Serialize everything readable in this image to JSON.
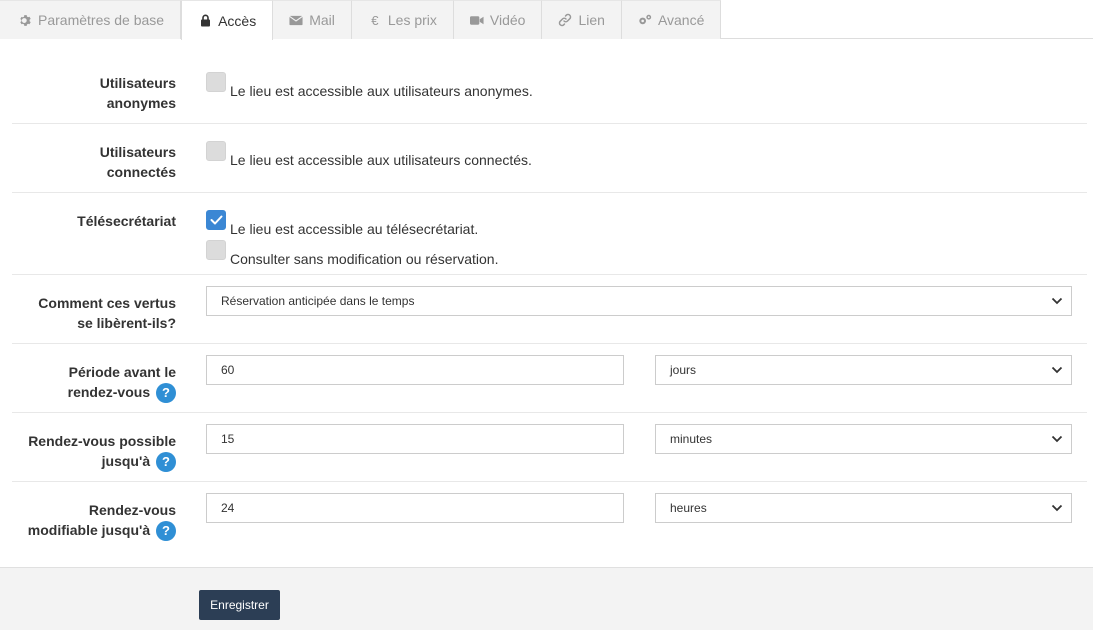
{
  "tabs": [
    {
      "label": "Paramètres de base",
      "icon": "gear-icon"
    },
    {
      "label": "Accès",
      "icon": "lock-icon"
    },
    {
      "label": "Mail",
      "icon": "envelope-icon"
    },
    {
      "label": "Les prix",
      "icon": "euro-icon"
    },
    {
      "label": "Vidéo",
      "icon": "video-camera-icon"
    },
    {
      "label": "Lien",
      "icon": "link-icon"
    },
    {
      "label": "Avancé",
      "icon": "gears-icon"
    }
  ],
  "active_tab": "Accès",
  "rows": {
    "anon": {
      "label_l1": "Utilisateurs",
      "label_l2": "anonymes",
      "checkbox_text": "Le lieu est accessible aux utilisateurs anonymes.",
      "checked": false
    },
    "connected": {
      "label_l1": "Utilisateurs",
      "label_l2": "connectés",
      "checkbox_text": "Le lieu est accessible aux utilisateurs connectés.",
      "checked": false
    },
    "telesec": {
      "label": "Télésecrétariat",
      "checkbox1_text": "Le lieu est accessible au télésecrétariat.",
      "checkbox1_checked": true,
      "checkbox2_text": "Consulter sans modification ou réservation.",
      "checkbox2_checked": false
    },
    "release": {
      "label_l1": "Comment ces vertus",
      "label_l2": "se libèrent-ils?",
      "select_value": "Réservation anticipée dans le temps"
    },
    "period": {
      "label_l1": "Période avant le",
      "label_l2": "rendez-vous",
      "help": "?",
      "value": "60",
      "unit": "jours"
    },
    "until": {
      "label_l1": "Rendez-vous possible",
      "label_l2": "jusqu'à",
      "help": "?",
      "value": "15",
      "unit": "minutes"
    },
    "modify": {
      "label_l1": "Rendez-vous",
      "label_l2": "modifiable jusqu'à",
      "help": "?",
      "value": "24",
      "unit": "heures"
    }
  },
  "footer": {
    "save_label": "Enregistrer"
  },
  "colors": {
    "checkbox_checked": "#3b87d4",
    "checkbox_unchecked": "#dcdcdc",
    "help_badge": "#2f8fd5",
    "save_button": "#2c3e55"
  }
}
